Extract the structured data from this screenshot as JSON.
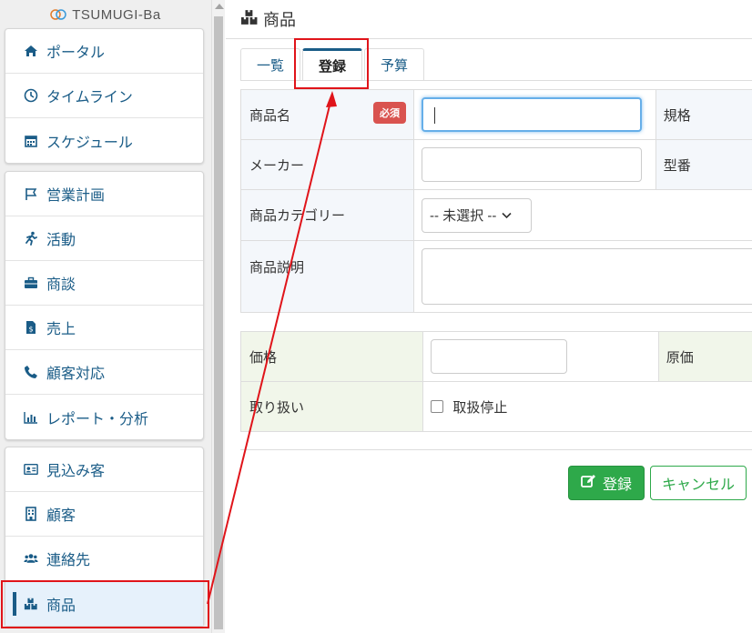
{
  "app": {
    "logo_text": "TSUMUGI-Ba"
  },
  "sidebar": {
    "group1": [
      {
        "label": "ポータル",
        "icon": "home-icon"
      },
      {
        "label": "タイムライン",
        "icon": "clock-icon"
      },
      {
        "label": "スケジュール",
        "icon": "calendar-icon"
      }
    ],
    "group2": [
      {
        "label": "営業計画",
        "icon": "flag-icon"
      },
      {
        "label": "活動",
        "icon": "running-icon"
      },
      {
        "label": "商談",
        "icon": "briefcase-icon"
      },
      {
        "label": "売上",
        "icon": "invoice-icon"
      },
      {
        "label": "顧客対応",
        "icon": "phone-icon"
      },
      {
        "label": "レポート・分析",
        "icon": "bar-chart-icon"
      }
    ],
    "group3": [
      {
        "label": "見込み客",
        "icon": "id-card-icon"
      },
      {
        "label": "顧客",
        "icon": "building-icon"
      },
      {
        "label": "連絡先",
        "icon": "users-icon"
      },
      {
        "label": "商品",
        "icon": "boxes-icon",
        "active": true
      }
    ]
  },
  "page": {
    "title": "商品"
  },
  "tabs": [
    {
      "label": "一覧"
    },
    {
      "label": "登録",
      "active": true
    },
    {
      "label": "予算"
    }
  ],
  "form": {
    "product_name_label": "商品名",
    "required_badge": "必須",
    "spec_label": "規格",
    "maker_label": "メーカー",
    "model_label": "型番",
    "category_label": "商品カテゴリー",
    "category_value": "-- 未選択 --",
    "description_label": "商品説明",
    "price_label": "価格",
    "cost_label": "原価",
    "handling_label": "取り扱い",
    "discontinued_label": "取扱停止",
    "discontinued_checked": false
  },
  "buttons": {
    "save": "登録",
    "cancel": "キャンセル"
  },
  "colors": {
    "accent": "#1a5c87",
    "save_green": "#2ea94a",
    "required_red": "#d9534f",
    "annotation_red": "#e0141a"
  }
}
